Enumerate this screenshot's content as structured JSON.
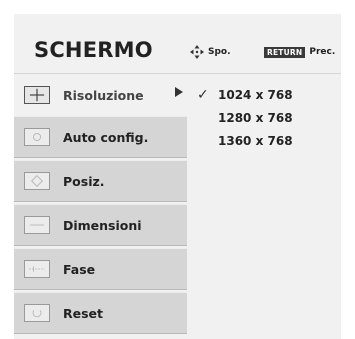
{
  "title": "SCHERMO",
  "hints": {
    "move_label": "Spo.",
    "return_key": "RETURN",
    "return_label": "Prec."
  },
  "menu": [
    {
      "label": "Risoluzione",
      "icon": "crosshair-icon",
      "active": true
    },
    {
      "label": "Auto config.",
      "icon": "auto-config-icon",
      "active": false
    },
    {
      "label": "Posiz.",
      "icon": "position-icon",
      "active": false
    },
    {
      "label": "Dimensioni",
      "icon": "size-icon",
      "active": false
    },
    {
      "label": "Fase",
      "icon": "phase-icon",
      "active": false
    },
    {
      "label": "Reset",
      "icon": "reset-icon",
      "active": false
    }
  ],
  "resolution_options": [
    {
      "label": "1024 x 768",
      "selected": true
    },
    {
      "label": "1280 x 768",
      "selected": false
    },
    {
      "label": "1360 x 768",
      "selected": false
    }
  ],
  "check_glyph": "✓"
}
